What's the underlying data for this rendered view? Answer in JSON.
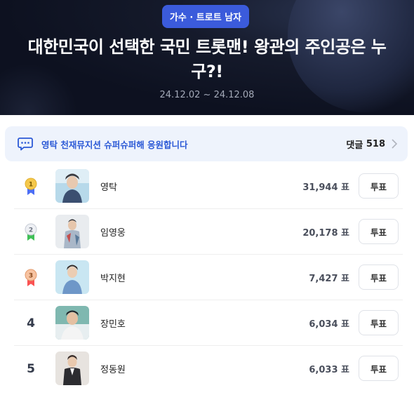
{
  "header": {
    "category_chip": "가수 · 트로트 남자",
    "title": "대한민국이 선택한 국민 트롯맨! 왕관의 주인공은 누구?!",
    "period": "24.12.02 ~ 24.12.08"
  },
  "banner": {
    "message": "영탁 천재뮤지션 슈퍼슈퍼해 응원합니다",
    "comments_label": "댓글",
    "comments_count": "518"
  },
  "ranking": [
    {
      "rank": "1",
      "name": "영탁",
      "votes": "31,944 표",
      "vote_label": "투표",
      "medal": "gold"
    },
    {
      "rank": "2",
      "name": "임영웅",
      "votes": "20,178 표",
      "vote_label": "투표",
      "medal": "silver"
    },
    {
      "rank": "3",
      "name": "박지현",
      "votes": "7,427 표",
      "vote_label": "투표",
      "medal": "bronze"
    },
    {
      "rank": "4",
      "name": "장민호",
      "votes": "6,034 표",
      "vote_label": "투표",
      "medal": ""
    },
    {
      "rank": "5",
      "name": "정동원",
      "votes": "6,033 표",
      "vote_label": "투표",
      "medal": ""
    }
  ],
  "colors": {
    "accent": "#3b5bdb",
    "banner_text": "#2b59d6",
    "banner_bg": "#eef3fc",
    "gold": "#f5c84b",
    "silver": "#dfe3ea",
    "bronze": "#f4b38a",
    "ribbon_blue": "#4c6ef5",
    "ribbon_green": "#40c057",
    "ribbon_red": "#fa5252"
  }
}
